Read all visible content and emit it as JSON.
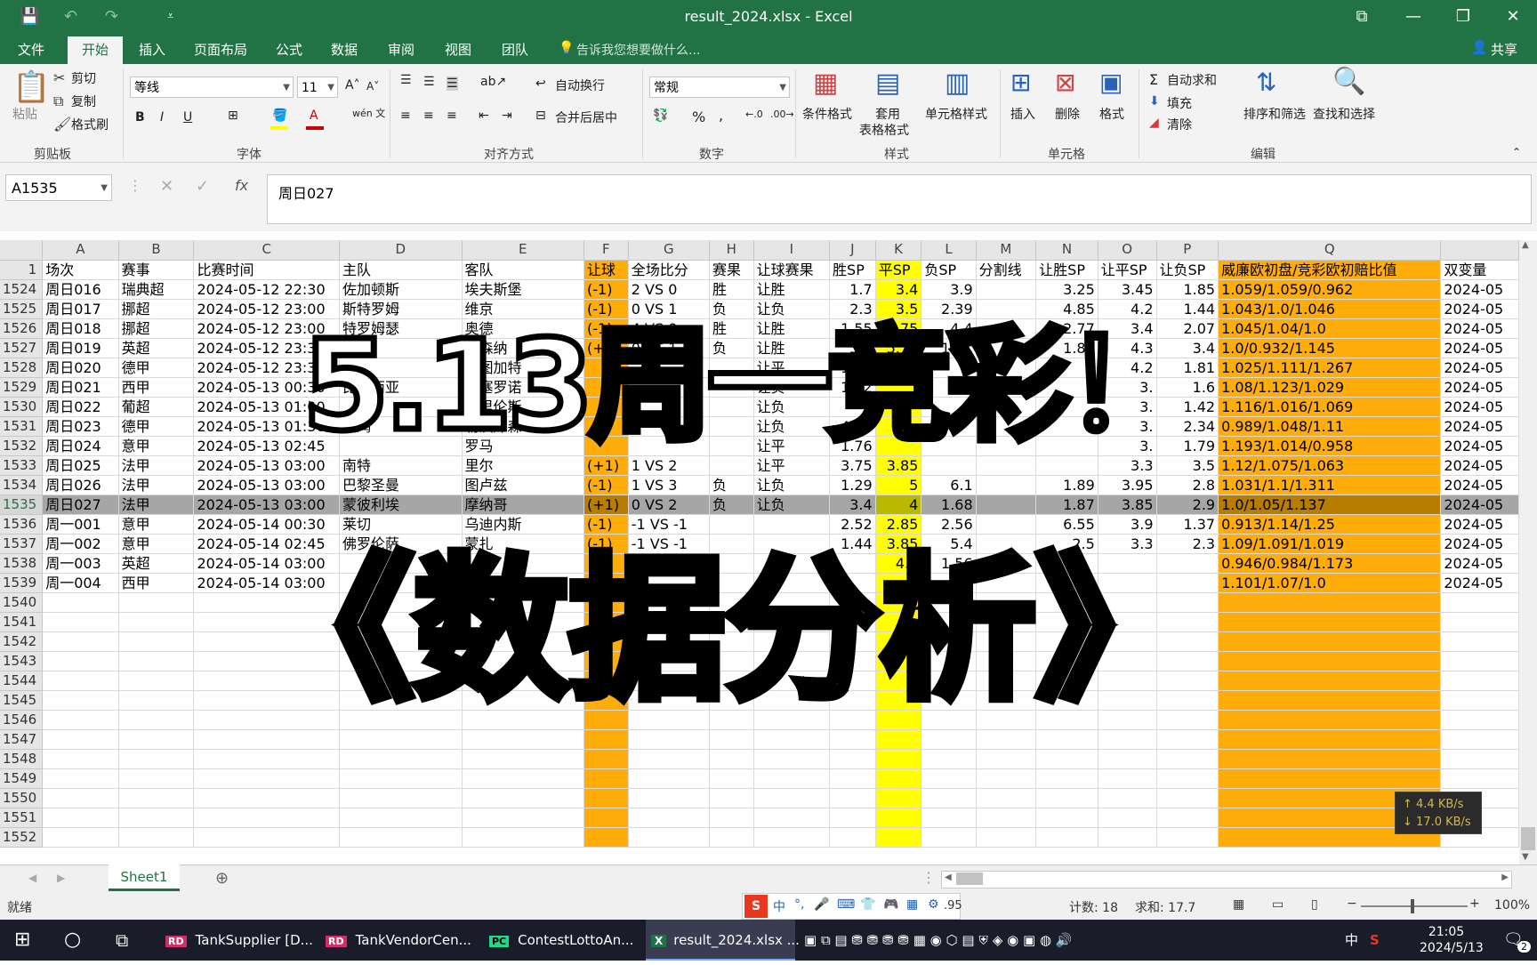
{
  "window": {
    "title": "result_2024.xlsx - Excel",
    "buttons": {
      "restore_icon": "ribbon-display-icon",
      "minimize": "—",
      "maximize": "❐",
      "close": "✕"
    }
  },
  "ribbon_tabs": [
    "文件",
    "开始",
    "插入",
    "页面布局",
    "公式",
    "数据",
    "审阅",
    "视图",
    "团队"
  ],
  "tell_me": "告诉我您想要做什么...",
  "share": "共享",
  "clipboard": {
    "paste": "粘贴",
    "cut": "剪切",
    "copy": "复制",
    "format_painter": "格式刷",
    "group": "剪贴板"
  },
  "font": {
    "name": "等线",
    "size": "11",
    "group": "字体",
    "bold": "B",
    "italic": "I",
    "underline": "U",
    "phonetic": "wén 文"
  },
  "alignment": {
    "wrap": "自动换行",
    "merge": "合并后居中",
    "group": "对齐方式"
  },
  "number": {
    "format": "常规",
    "group": "数字"
  },
  "styles": {
    "conditional": "条件格式",
    "table_line1": "套用",
    "table_line2": "表格格式",
    "cell_styles": "单元格样式",
    "group": "样式"
  },
  "cells": {
    "insert": "插入",
    "delete": "删除",
    "format": "格式",
    "group": "单元格"
  },
  "editing": {
    "autosum": "自动求和",
    "fill": "填充",
    "clear": "清除",
    "sort": "排序和筛选",
    "find": "查找和选择",
    "group": "编辑"
  },
  "formula_bar": {
    "name_box": "A1535",
    "fx": "fx",
    "content": "周日027"
  },
  "columns": [
    "A",
    "B",
    "C",
    "D",
    "E",
    "F",
    "G",
    "H",
    "I",
    "J",
    "K",
    "L",
    "M",
    "N",
    "O",
    "P",
    "Q",
    ""
  ],
  "header_row": {
    "num": "1",
    "cells": [
      "场次",
      "赛事",
      "比赛时间",
      "主队",
      "客队",
      "让球",
      "全场比分",
      "赛果",
      "让球赛果",
      "胜SP",
      "平SP",
      "负SP",
      "分割线",
      "让胜SP",
      "让平SP",
      "让负SP",
      "威廉欧初盘/竞彩欧初赔比值",
      "双变量"
    ]
  },
  "rows": [
    {
      "num": "1524",
      "cells": [
        "周日016",
        "瑞典超",
        "2024-05-12 22:30",
        "佐加顿斯",
        "埃夫斯堡",
        "(-1)",
        "2 VS 0",
        "胜",
        "让胜",
        "1.7",
        "3.4",
        "3.9",
        "",
        "3.25",
        "3.45",
        "1.85",
        "1.059/1.059/0.962",
        "2024-05"
      ]
    },
    {
      "num": "1525",
      "cells": [
        "周日017",
        "挪超",
        "2024-05-12 23:00",
        "斯特罗姆",
        "维京",
        "(-1)",
        "0 VS 1",
        "负",
        "让负",
        "2.3",
        "3.5",
        "2.39",
        "",
        "4.85",
        "4.2",
        "1.44",
        "1.043/1.0/1.046",
        "2024-05"
      ]
    },
    {
      "num": "1526",
      "cells": [
        "周日018",
        "挪超",
        "2024-05-12 23:00",
        "特罗姆瑟",
        "奥德",
        "(-1)",
        "4 VS 0",
        "胜",
        "让胜",
        "1.55",
        "3.75",
        "4.4",
        "",
        "2.77",
        "3.4",
        "2.07",
        "1.045/1.04/1.0",
        "2024-05"
      ]
    },
    {
      "num": "1527",
      "cells": [
        "周日019",
        "英超",
        "2024-05-12 23:30",
        "曼联",
        "阿森纳",
        "(+2)",
        "0 VS 1",
        "负",
        "让胜",
        "5.5",
        "5.15",
        "1.31",
        "",
        "1.84",
        "4.3",
        "3.4",
        "1.0/0.932/1.145",
        "2024-05"
      ]
    },
    {
      "num": "1528",
      "cells": [
        "周日020",
        "德甲",
        "2024-05-12 23:30",
        "",
        "斯图加特",
        "",
        "",
        "",
        "让平",
        "1.22",
        "",
        "",
        "",
        "",
        "4.2",
        "1.81",
        "1.025/1.111/1.267",
        "2024-05"
      ]
    },
    {
      "num": "1529",
      "cells": [
        "周日021",
        "西甲",
        "2024-05-13 00:30",
        "比伦西亚",
        "巴塞罗诺",
        "",
        "",
        "",
        "让负",
        "1.32",
        "",
        "",
        "",
        "",
        "3.",
        "1.6",
        "1.08/1.123/1.029",
        "2024-05"
      ]
    },
    {
      "num": "1530",
      "cells": [
        "周日022",
        "葡超",
        "2024-05-13 01:00",
        "",
        "摩里伦斯",
        "",
        "",
        "",
        "让负",
        "",
        "",
        "",
        "",
        "",
        "3.",
        "1.42",
        "1.116/1.016/1.069",
        "2024-05"
      ]
    },
    {
      "num": "1531",
      "cells": [
        "周日023",
        "德甲",
        "2024-05-13 01:30",
        "波鸿",
        "勒沃库森",
        "",
        "",
        "",
        "让负",
        "4.65",
        "",
        "",
        "",
        "",
        "3.",
        "2.34",
        "0.989/1.048/1.11",
        "2024-05"
      ]
    },
    {
      "num": "1532",
      "cells": [
        "周日024",
        "意甲",
        "2024-05-13 02:45",
        "",
        "罗马",
        "",
        "",
        "",
        "让平",
        "1.76",
        "",
        "",
        "",
        "",
        "3.",
        "1.79",
        "1.193/1.014/0.958",
        "2024-05"
      ]
    },
    {
      "num": "1533",
      "cells": [
        "周日025",
        "法甲",
        "2024-05-13 03:00",
        "南特",
        "里尔",
        "(+1)",
        "1 VS 2",
        "",
        "让平",
        "3.75",
        "3.85",
        "",
        "",
        "",
        "3.3",
        "3.5",
        "1.12/1.075/1.063",
        "2024-05"
      ]
    },
    {
      "num": "1534",
      "cells": [
        "周日026",
        "法甲",
        "2024-05-13 03:00",
        "巴黎圣曼",
        "图卢兹",
        "(-1)",
        "1 VS 3",
        "负",
        "让负",
        "1.29",
        "5",
        "6.1",
        "",
        "1.89",
        "3.95",
        "2.8",
        "1.031/1.1/1.311",
        "2024-05"
      ]
    },
    {
      "num": "1535",
      "cells": [
        "周日027",
        "法甲",
        "2024-05-13 03:00",
        "蒙彼利埃",
        "摩纳哥",
        "(+1)",
        "0 VS 2",
        "负",
        "让负",
        "3.4",
        "4",
        "1.68",
        "",
        "1.87",
        "3.85",
        "2.9",
        "1.0/1.05/1.137",
        "2024-05"
      ]
    },
    {
      "num": "1536",
      "cells": [
        "周一001",
        "意甲",
        "2024-05-14 00:30",
        "莱切",
        "乌迪内斯",
        "(-1)",
        "-1 VS -1",
        "",
        "",
        "2.52",
        "2.85",
        "2.56",
        "",
        "6.55",
        "3.9",
        "1.37",
        "0.913/1.14/1.25",
        "2024-05"
      ]
    },
    {
      "num": "1537",
      "cells": [
        "周一002",
        "意甲",
        "2024-05-14 02:45",
        "佛罗伦萨",
        "蒙扎",
        "(-1)",
        "-1 VS -1",
        "",
        "",
        "1.44",
        "3.85",
        "5.4",
        "",
        "2.5",
        "3.3",
        "2.3",
        "1.09/1.091/1.019",
        "2024-05"
      ]
    },
    {
      "num": "1538",
      "cells": [
        "周一003",
        "英超",
        "2024-05-14 03:00",
        "",
        "",
        "",
        "",
        "",
        "",
        "",
        "4.4",
        "1.56",
        "",
        "",
        "",
        "",
        "0.946/0.984/1.173",
        "2024-05"
      ]
    },
    {
      "num": "1539",
      "cells": [
        "周一004",
        "西甲",
        "2024-05-14 03:00",
        "",
        "",
        "",
        "",
        "",
        "",
        "",
        "",
        "",
        "",
        "",
        "",
        "",
        "1.101/1.07/1.0",
        "2024-05"
      ]
    },
    {
      "num": "1540",
      "cells": [
        "",
        "",
        "",
        "",
        "",
        "",
        "",
        "",
        "",
        "",
        "",
        "",
        "",
        "",
        "",
        "",
        "",
        ""
      ]
    },
    {
      "num": "1541",
      "cells": [
        "",
        "",
        "",
        "",
        "",
        "",
        "",
        "",
        "",
        "",
        "",
        "",
        "",
        "",
        "",
        "",
        "",
        ""
      ]
    },
    {
      "num": "1542",
      "cells": [
        "",
        "",
        "",
        "",
        "",
        "",
        "",
        "",
        "",
        "",
        "",
        "",
        "",
        "",
        "",
        "",
        "",
        ""
      ]
    },
    {
      "num": "1543",
      "cells": [
        "",
        "",
        "",
        "",
        "",
        "",
        "",
        "",
        "",
        "",
        "",
        "",
        "",
        "",
        "",
        "",
        "",
        ""
      ]
    },
    {
      "num": "1544",
      "cells": [
        "",
        "",
        "",
        "",
        "",
        "",
        "",
        "",
        "",
        "",
        "",
        "",
        "",
        "",
        "",
        "",
        "",
        ""
      ]
    },
    {
      "num": "1545",
      "cells": [
        "",
        "",
        "",
        "",
        "",
        "",
        "",
        "",
        "",
        "",
        "",
        "",
        "",
        "",
        "",
        "",
        "",
        ""
      ]
    },
    {
      "num": "1546",
      "cells": [
        "",
        "",
        "",
        "",
        "",
        "",
        "",
        "",
        "",
        "",
        "",
        "",
        "",
        "",
        "",
        "",
        "",
        ""
      ]
    },
    {
      "num": "1547",
      "cells": [
        "",
        "",
        "",
        "",
        "",
        "",
        "",
        "",
        "",
        "",
        "",
        "",
        "",
        "",
        "",
        "",
        "",
        ""
      ]
    },
    {
      "num": "1548",
      "cells": [
        "",
        "",
        "",
        "",
        "",
        "",
        "",
        "",
        "",
        "",
        "",
        "",
        "",
        "",
        "",
        "",
        "",
        ""
      ]
    },
    {
      "num": "1549",
      "cells": [
        "",
        "",
        "",
        "",
        "",
        "",
        "",
        "",
        "",
        "",
        "",
        "",
        "",
        "",
        "",
        "",
        "",
        ""
      ]
    },
    {
      "num": "1550",
      "cells": [
        "",
        "",
        "",
        "",
        "",
        "",
        "",
        "",
        "",
        "",
        "",
        "",
        "",
        "",
        "",
        "",
        "",
        ""
      ]
    },
    {
      "num": "1551",
      "cells": [
        "",
        "",
        "",
        "",
        "",
        "",
        "",
        "",
        "",
        "",
        "",
        "",
        "",
        "",
        "",
        "",
        "",
        ""
      ]
    },
    {
      "num": "1552",
      "cells": [
        "",
        "",
        "",
        "",
        "",
        "",
        "",
        "",
        "",
        "",
        "",
        "",
        "",
        "",
        "",
        "",
        "",
        ""
      ]
    }
  ],
  "selected_row": "1535",
  "overlay": {
    "line1": "5.13周一竞彩！",
    "line2": "《数据分析》"
  },
  "sheet_tab": "Sheet1",
  "status": {
    "ready": "就绪",
    "partial": ".95",
    "count": "计数: 18",
    "sum": "求和: 17.7",
    "zoom": "100%"
  },
  "net_speed": {
    "up": "↑ 4.4 KB/s",
    "down": "↓ 17.0 KB/s"
  },
  "taskbar": {
    "items": [
      "TankSupplier [D...",
      "TankVendorCen...",
      "ContestLottoAn...",
      "result_2024.xlsx ..."
    ],
    "time": "21:05",
    "date": "2024/5/13",
    "ime": "中",
    "notif": "2"
  },
  "colors": {
    "excel_green": "#217346",
    "orange": "#ffad0a",
    "yellow": "#ffff00",
    "overlay_yellow": "#ffe92b"
  }
}
